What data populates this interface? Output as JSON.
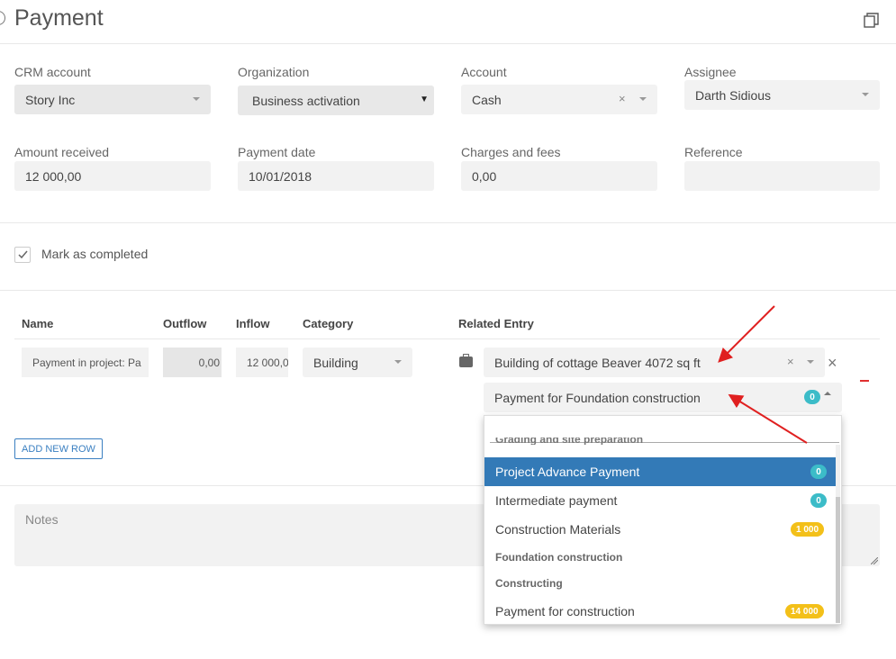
{
  "header": {
    "title": "Payment"
  },
  "form": {
    "crm_account": {
      "label": "CRM account",
      "value": "Story Inc"
    },
    "organization": {
      "label": "Organization",
      "value": "Business activation"
    },
    "account": {
      "label": "Account",
      "value": "Cash"
    },
    "assignee": {
      "label": "Assignee",
      "value": "Darth Sidious"
    },
    "amount_received": {
      "label": "Amount received",
      "value": "12 000,00"
    },
    "payment_date": {
      "label": "Payment date",
      "value": "10/01/2018"
    },
    "charges_fees": {
      "label": "Charges and fees",
      "value": "0,00"
    },
    "reference": {
      "label": "Reference",
      "value": ""
    }
  },
  "mark_completed": {
    "label": "Mark as completed",
    "checked": true
  },
  "table": {
    "headers": {
      "name": "Name",
      "outflow": "Outflow",
      "inflow": "Inflow",
      "category": "Category",
      "related_entry": "Related Entry"
    },
    "row": {
      "name": "Payment in project:  Pa",
      "outflow": "0,00",
      "inflow": "12 000,0",
      "category": "Building",
      "related_project": "Building of cottage Beaver 4072 sq ft",
      "related_entry": "Payment for Foundation construction",
      "related_entry_badge": "0"
    }
  },
  "add_row_label": "ADD NEW ROW",
  "notes": {
    "placeholder": "Notes"
  },
  "dropdown": {
    "partial_item": "Grading and site preparation",
    "items": [
      {
        "label": "Project Advance Payment",
        "badge": "0",
        "badge_color": "#3cbcc8",
        "active": true
      },
      {
        "label": "Intermediate payment",
        "badge": "0",
        "badge_color": "#3cbcc8",
        "active": false
      },
      {
        "label": "Construction Materials",
        "badge": "1 000",
        "badge_color": "#f3c019",
        "active": false
      }
    ],
    "group_foundation": "Foundation construction",
    "group_constructing": "Constructing",
    "last_item": {
      "label": "Payment for construction",
      "badge": "14 000",
      "badge_color": "#f3c019"
    }
  },
  "colors": {
    "accent": "#337ab7",
    "annotation": "#e02020"
  }
}
